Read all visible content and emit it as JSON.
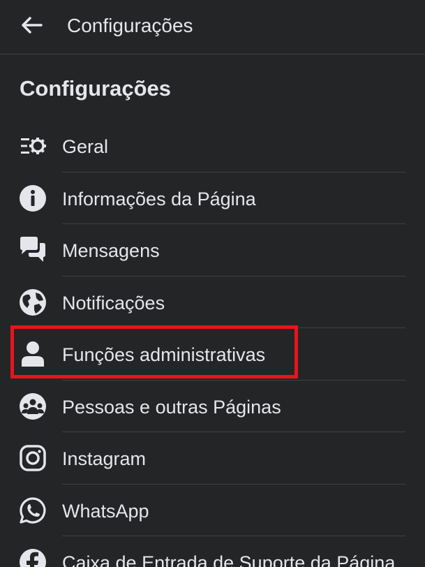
{
  "header": {
    "title": "Configurações",
    "back_icon": "arrow-left-icon"
  },
  "section": {
    "title": "Configurações"
  },
  "menu": {
    "items": [
      {
        "label": "Geral",
        "icon": "settings-list-icon"
      },
      {
        "label": "Informações da Página",
        "icon": "info-icon"
      },
      {
        "label": "Mensagens",
        "icon": "chat-bubbles-icon"
      },
      {
        "label": "Notificações",
        "icon": "globe-icon"
      },
      {
        "label": "Funções administrativas",
        "icon": "person-icon"
      },
      {
        "label": "Pessoas e outras Páginas",
        "icon": "people-group-icon"
      },
      {
        "label": "Instagram",
        "icon": "instagram-icon"
      },
      {
        "label": "WhatsApp",
        "icon": "whatsapp-icon"
      },
      {
        "label": "Caixa de Entrada de Suporte da Página",
        "icon": "facebook-icon"
      }
    ]
  },
  "colors": {
    "background": "#242526",
    "text": "#e4e6eb",
    "divider": "#3e4042",
    "highlight": "#e8141c"
  }
}
